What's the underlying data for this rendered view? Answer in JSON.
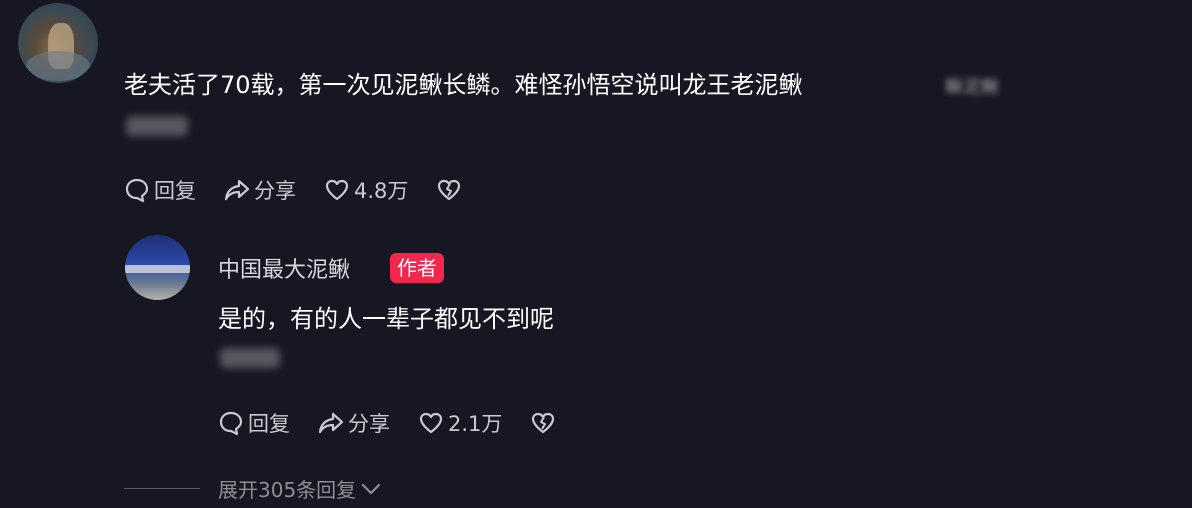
{
  "main_comment": {
    "text": "老夫活了70载，第一次见泥鳅长鳞。难怪孙悟空说叫龙王老泥鳅",
    "blurred_tag": "鳅泥鳅",
    "actions": {
      "reply_label": "回复",
      "share_label": "分享",
      "like_count": "4.8万"
    }
  },
  "reply": {
    "username": "中国最大泥鳅",
    "badge": "作者",
    "text": "是的，有的人一辈子都见不到呢",
    "actions": {
      "reply_label": "回复",
      "share_label": "分享",
      "like_count": "2.1万"
    }
  },
  "expand": {
    "label": "展开305条回复"
  },
  "colors": {
    "background": "#161722",
    "badge": "#f3264d",
    "action_text": "#c9cad0",
    "muted": "#8d8e95"
  }
}
